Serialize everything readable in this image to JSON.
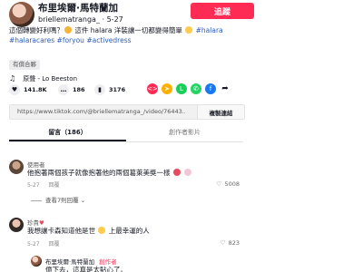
{
  "header": {
    "author_name": "布里埃爾·馬特蘭加",
    "username": "briellematranga_",
    "date": "5-27",
    "follow_label": "追蹤"
  },
  "caption": {
    "text_1": "這個轉變好利嗎？",
    "text_2": " 這件 halara 洋裝讓一切都變得簡單 ",
    "tags": [
      "#halara",
      "#halaracares",
      "#foryou",
      "#activedress"
    ]
  },
  "category_badge": "有償合夥",
  "music": {
    "label": "原聲 - Lo Beeston"
  },
  "actions": {
    "likes": "141.8K",
    "comments": "186",
    "saves": "3176"
  },
  "share_colors": [
    "#fe2c55",
    "#ffb000",
    "#1ccc5b",
    "#25d366",
    "#1877f2"
  ],
  "link": {
    "url": "https://www.tiktok.com/@briellematranga_/video/76443...",
    "copy_label": "複製連結"
  },
  "tabs": [
    {
      "label": "留言（186）",
      "active": true
    },
    {
      "label": "創作者影片",
      "active": false
    }
  ],
  "comments": [
    {
      "user": "使用者",
      "text": "他抱著兩個孩子就像抱著他的兩個葛萊美獎一樣",
      "date": "5-27",
      "reply_label": "回覆",
      "likes": "5008",
      "view_replies": "查看7則回覆"
    },
    {
      "user": "珍貴",
      "text": "我想讓卡森知道他是世",
      "text_2": "上最幸運的人",
      "date": "5-27",
      "reply_label": "回覆",
      "likes": "823"
    },
    {
      "user": "布里埃爾·馬特蘭加",
      "creator_label": "創作者",
      "text": "億下去，這真是太貼心了。"
    }
  ],
  "colors": {
    "accent": "#fe2c55",
    "link": "#2b5db9",
    "text": "#161823"
  }
}
